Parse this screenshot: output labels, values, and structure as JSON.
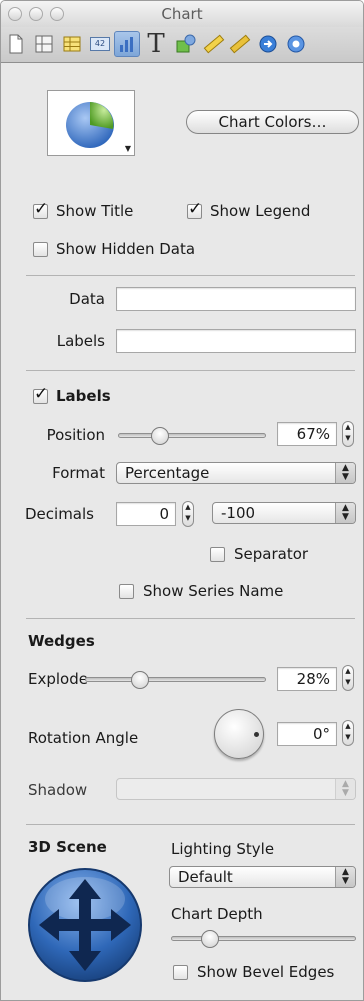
{
  "window": {
    "title": "Chart"
  },
  "toolbar": {
    "items": [
      {
        "name": "document-icon"
      },
      {
        "name": "layout-icon"
      },
      {
        "name": "table-icon"
      },
      {
        "name": "metrics-icon",
        "label": "42"
      },
      {
        "name": "chart-icon",
        "active": true
      },
      {
        "name": "text-icon",
        "label": "T"
      },
      {
        "name": "graphic-icon"
      },
      {
        "name": "ruler-icon"
      },
      {
        "name": "link-icon"
      },
      {
        "name": "qt-icon"
      }
    ]
  },
  "chart": {
    "type_icon": "pie-chart-icon",
    "colors_button": "Chart Colors…",
    "show_title": {
      "label": "Show Title",
      "checked": true
    },
    "show_legend": {
      "label": "Show Legend",
      "checked": true
    },
    "show_hidden": {
      "label": "Show Hidden Data",
      "checked": false
    }
  },
  "data_section": {
    "data_label": "Data",
    "data_value": "",
    "labels_label": "Labels",
    "labels_value": ""
  },
  "labels_section": {
    "header": {
      "label": "Labels",
      "checked": true
    },
    "position_label": "Position",
    "position_value": "67%",
    "position_fraction": 0.25,
    "format_label": "Format",
    "format_value": "Percentage",
    "decimals_label": "Decimals",
    "decimals_value": "0",
    "negative_value": "-100",
    "separator": {
      "label": "Separator",
      "checked": false
    },
    "series_name": {
      "label": "Show Series Name",
      "checked": false
    }
  },
  "wedges": {
    "header": "Wedges",
    "explode_label": "Explode",
    "explode_value": "28%",
    "explode_fraction": 0.28,
    "rotation_label": "Rotation Angle",
    "rotation_value": "0°",
    "shadow_label": "Shadow",
    "shadow_value": ""
  },
  "scene": {
    "header": "3D Scene",
    "lighting_label": "Lighting Style",
    "lighting_value": "Default",
    "depth_label": "Chart Depth",
    "depth_fraction": 0.18,
    "bevel": {
      "label": "Show Bevel Edges",
      "checked": false
    }
  },
  "colors": {
    "accent": "#3f7fd6",
    "pie_blue": "#3c78d0",
    "pie_green": "#7ec64a",
    "scene_blue": "#2f68b8"
  }
}
